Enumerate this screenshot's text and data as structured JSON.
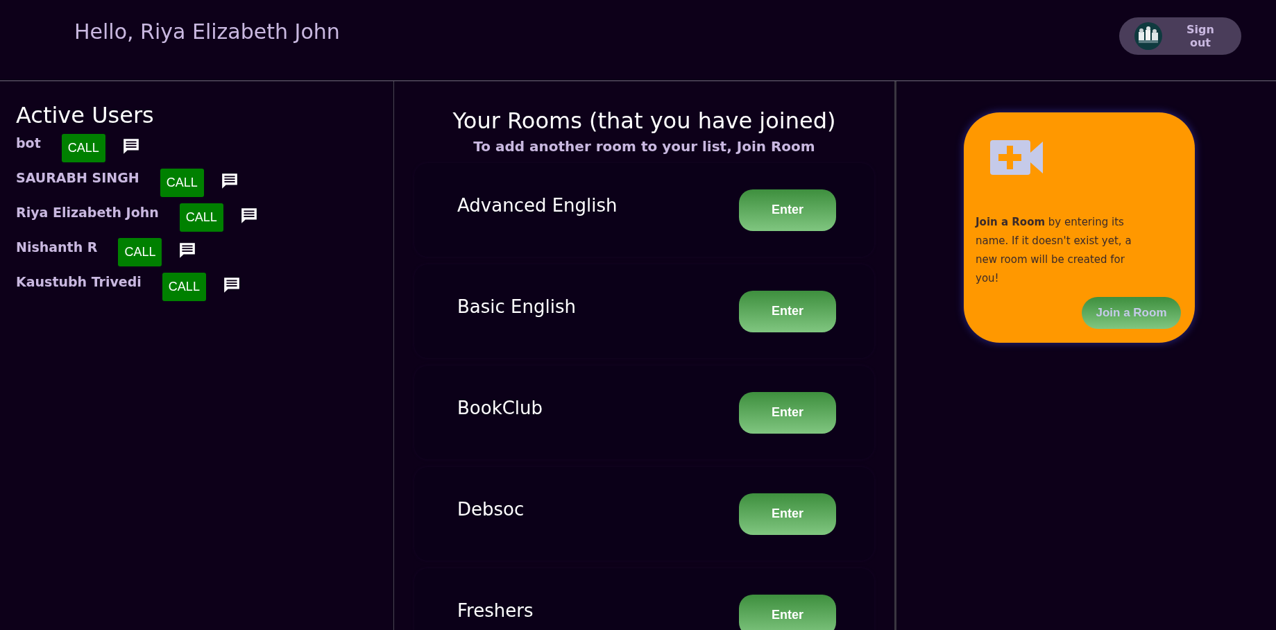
{
  "header": {
    "greeting": "Hello, Riya Elizabeth John",
    "sign_out": "Sign out"
  },
  "active_users": {
    "title": "Active Users",
    "users": [
      {
        "name": "bot",
        "call": "CALL"
      },
      {
        "name": "SAURABH SINGH",
        "call": "CALL"
      },
      {
        "name": "Riya Elizabeth John",
        "call": "CALL"
      },
      {
        "name": "Nishanth R",
        "call": "CALL"
      },
      {
        "name": "Kaustubh Trivedi",
        "call": "CALL"
      }
    ]
  },
  "rooms": {
    "title": "Your Rooms (that you have joined)",
    "subtitle": "To add another room to your list, **Join Room**",
    "items": [
      {
        "name": "Advanced English",
        "button": "Enter"
      },
      {
        "name": "Basic English",
        "button": "Enter"
      },
      {
        "name": "BookClub",
        "button": "Enter"
      },
      {
        "name": "Debsoc",
        "button": "Enter"
      },
      {
        "name": "Freshers",
        "button": "Enter"
      }
    ]
  },
  "join_card": {
    "text": "**Join a Room** by entering its name. If it doesn't exist yet, a new room will be created for you!",
    "button": "Join a Room"
  }
}
